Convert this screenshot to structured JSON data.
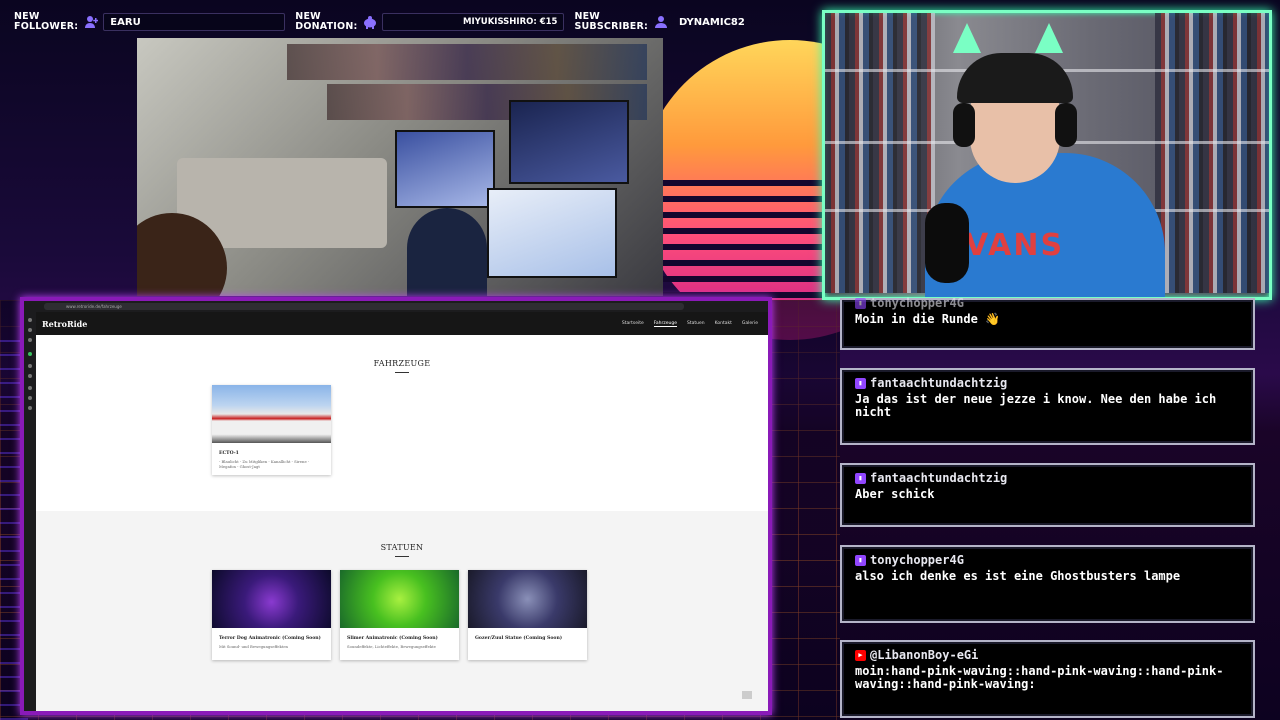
{
  "alerts": {
    "follower_label_1": "NEW",
    "follower_label_2": "FOLLOWER:",
    "follower_name": "EARU",
    "donation_label_1": "NEW",
    "donation_label_2": "DONATION:",
    "donation_text": "MIYUKISSHIRO: €15",
    "subscriber_label_1": "NEW",
    "subscriber_label_2": "SUBSCRIBER:",
    "subscriber_name": "DYNAMIC82",
    "icon_color": "#8a70ff"
  },
  "browser": {
    "url": "www.retroride.de/fahrzeuge",
    "brand": "RetroRide",
    "nav": [
      "Startseite",
      "Fahrzeuge",
      "Statuen",
      "Kontakt",
      "Galerie"
    ],
    "active_nav": "Fahrzeuge",
    "sections": {
      "vehicles_title": "FAHRZEUGE",
      "statues_title": "STATUEN"
    },
    "vehicles": [
      {
        "title": "ECTO-1",
        "subtitle": "- Blaulicht - Zu Mitgliken - Kanallicht - Sirene - Megafon - Ghost-Jagt"
      }
    ],
    "statues": [
      {
        "title": "Terror Dog Animatronic (Coming Soon)",
        "subtitle": "Mit Sound- und Bewegungseffekten"
      },
      {
        "title": "Slimer Animatronic (Coming Soon)",
        "subtitle": "Soundeffekte, Lichteffekte, Bewegungseffekte"
      },
      {
        "title": "Gozer/Zuul Statue (Coming Soon)",
        "subtitle": ""
      }
    ]
  },
  "chat": {
    "messages": [
      {
        "platform": "twitch",
        "user": "tonychopper4G",
        "text": "Moin in die Runde 👋"
      },
      {
        "platform": "twitch",
        "user": "fantaachtundachtzig",
        "text": "Ja das ist der neue jezze i know. Nee den habe ich nicht"
      },
      {
        "platform": "twitch",
        "user": "fantaachtundachtzig",
        "text": "Aber schick"
      },
      {
        "platform": "twitch",
        "user": "tonychopper4G",
        "text": "also ich denke es ist eine Ghostbusters lampe"
      },
      {
        "platform": "youtube",
        "user": "@LibanonBoy-eGi",
        "text": "moin:hand-pink-waving::hand-pink-waving::hand-pink-waving::hand-pink-waving:"
      }
    ]
  },
  "facecam": {
    "shirt_text": "VANS",
    "frame_color": "#7affc4"
  }
}
